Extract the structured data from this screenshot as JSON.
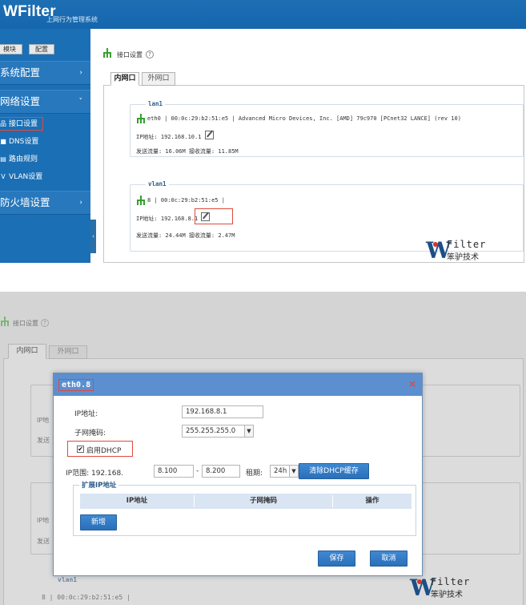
{
  "top": {
    "app": {
      "logo": "WFilter",
      "subtitle": "上网行为管理系统"
    },
    "sidebar": {
      "tabs": [
        "模块",
        "配置"
      ],
      "sections": [
        {
          "label": "系统配置",
          "chevron": "›"
        },
        {
          "label": "网络设置",
          "chevron": "˅"
        },
        {
          "label": "防火墙设置",
          "chevron": "›"
        }
      ],
      "sub_items": [
        "接口设置",
        "DNS设置",
        "路由规则",
        "VLAN设置"
      ]
    },
    "page": {
      "breadcrumb": "接口设置",
      "help": "?",
      "tabs": [
        "内网口",
        "外网口"
      ],
      "lan": {
        "legend": "lan1",
        "device_line": "eth0 | 00:0c:29:b2:51:e5 | Advanced Micro Devices, Inc. [AMD] 79c970 [PCnet32 LANCE] (rev 10)",
        "ip_line": "IP地址: 192.168.10.1",
        "traffic_line": "发送流量: 16.06M   接收流量: 11.85M"
      },
      "vlan": {
        "legend": "vlan1",
        "device_line": "8 | 00:0c:29:b2:51:e5 |",
        "ip_line": "IP地址: 192.168.8.1",
        "traffic_line": "发送流量: 24.44M   接收流量: 2.47M"
      }
    },
    "brand": {
      "name": "Filter",
      "cn": "笨驴技术"
    }
  },
  "bottom": {
    "breadcrumb": "接口设置",
    "help": "?",
    "tabs": [
      "内网口",
      "外网口"
    ],
    "bg_labels": {
      "ip": "IP地",
      "send": "发送",
      "vlan": "vlan1",
      "line": "8 | 00:0c:29:b2:51:e5 |"
    },
    "dialog": {
      "title": "eth0.8",
      "close": "×",
      "ip_label": "IP地址:",
      "ip_value": "192.168.8.1",
      "mask_label": "子网掩码:",
      "mask_value": "255.255.255.0",
      "dhcp_label": "启用DHCP",
      "dhcp_checked": "✔",
      "range_label": "IP范围: 192.168.",
      "range_start": "8.100",
      "range_dash": "-",
      "range_end": "8.200",
      "lease_label": "租期:",
      "lease_value": "24h",
      "clear_cache_button": "清除DHCP缓存",
      "ext_legend": "扩展IP地址",
      "ext_table_headers": [
        "IP地址",
        "子网掩码",
        "操作"
      ],
      "add_button": "新增",
      "save_button": "保存",
      "cancel_button": "取消"
    },
    "brand": {
      "name": "Filter",
      "cn": "笨驴技术"
    }
  },
  "colors": {
    "header_blue": "#1566ad",
    "sidebar_blue": "#1b6fb5",
    "dialog_header": "#5b8fd0",
    "button_blue": "#2a6fb9",
    "highlight_red": "#e04a3c",
    "icon_green": "#35a02d"
  }
}
